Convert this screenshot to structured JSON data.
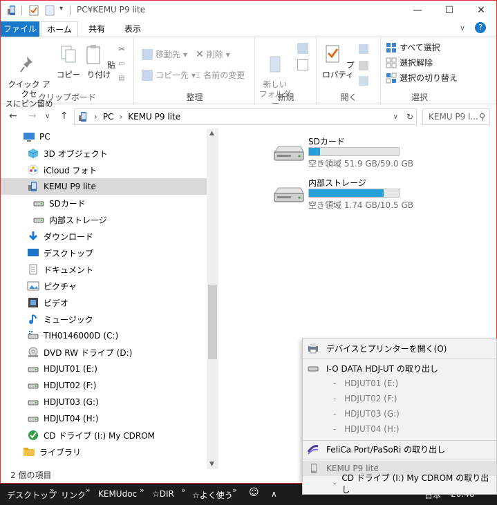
{
  "window": {
    "title": "PC¥KEMU P9 lite"
  },
  "titlebar": {
    "minimize_icon": "minimize-icon",
    "maximize_icon": "maximize-icon",
    "close_icon": "close-icon"
  },
  "tabs": [
    {
      "label": "ファイル"
    },
    {
      "label": "ホーム"
    },
    {
      "label": "共有"
    },
    {
      "label": "表示"
    }
  ],
  "ribbon": {
    "clipboard": {
      "label": "クリップボード",
      "pin": "クイック アクセ\nスにピン留め",
      "copy": "コピー",
      "paste": "貼り付け"
    },
    "organize": {
      "label": "整理",
      "move_to": "移動先",
      "copy_to": "コピー先",
      "delete": "削除",
      "rename": "名前の変更"
    },
    "new": {
      "label": "新規",
      "new_folder": "新しい\nフォルダー"
    },
    "open": {
      "label": "開く",
      "properties": "プロパティ"
    },
    "select": {
      "label": "選択",
      "select_all": "すべて選択",
      "select_none": "選択解除",
      "invert": "選択の切り替え"
    }
  },
  "address": {
    "path": [
      "PC",
      "KEMU P9 lite"
    ],
    "search_placeholder": "KEMU P9 l..."
  },
  "nav": {
    "items": [
      {
        "label": "PC",
        "icon": "pc-icon",
        "indent": 0
      },
      {
        "label": "3D オブジェクト",
        "icon": "3d-objects-icon",
        "indent": 1
      },
      {
        "label": "iCloud フォト",
        "icon": "icloud-photos-icon",
        "indent": 1
      },
      {
        "label": "KEMU P9 lite",
        "icon": "phone-icon",
        "indent": 1,
        "selected": true
      },
      {
        "label": "SDカード",
        "icon": "drive-icon",
        "indent": 2
      },
      {
        "label": "内部ストレージ",
        "icon": "drive-icon",
        "indent": 2
      },
      {
        "label": "ダウンロード",
        "icon": "download-icon",
        "indent": 1
      },
      {
        "label": "デスクトップ",
        "icon": "desktop-icon",
        "indent": 1
      },
      {
        "label": "ドキュメント",
        "icon": "documents-icon",
        "indent": 1
      },
      {
        "label": "ピクチャ",
        "icon": "pictures-icon",
        "indent": 1
      },
      {
        "label": "ビデオ",
        "icon": "videos-icon",
        "indent": 1
      },
      {
        "label": "ミュージック",
        "icon": "music-icon",
        "indent": 1
      },
      {
        "label": "TIH0146000D (C:)",
        "icon": "system-drive-icon",
        "indent": 1
      },
      {
        "label": "DVD RW ドライブ (D:)",
        "icon": "dvd-icon",
        "indent": 1
      },
      {
        "label": "HDJUT01 (E:)",
        "icon": "drive-icon",
        "indent": 1
      },
      {
        "label": "HDJUT02 (F:)",
        "icon": "drive-icon",
        "indent": 1
      },
      {
        "label": "HDJUT03 (G:)",
        "icon": "drive-icon",
        "indent": 1
      },
      {
        "label": "HDJUT04 (H:)",
        "icon": "drive-icon",
        "indent": 1
      },
      {
        "label": "CD ドライブ (I:) My CDROM",
        "icon": "cd-icon",
        "indent": 1
      },
      {
        "label": "ライブラリ",
        "icon": "library-icon",
        "indent": 0
      }
    ]
  },
  "content": {
    "drives": [
      {
        "name": "SDカード",
        "free": "空き領域 51.9 GB/59.0 GB",
        "used_fraction": 0.12
      },
      {
        "name": "内部ストレージ",
        "free": "空き領域 1.74 GB/10.5 GB",
        "used_fraction": 0.83
      }
    ]
  },
  "status": {
    "count": "2 個の項目"
  },
  "taskbar": {
    "toolbars": [
      "デスクトップ",
      "リンク",
      "KEMUdoc",
      "☆DIR",
      "☆よく使う"
    ],
    "chevron": "»",
    "lang": "日本",
    "time": "20:48"
  },
  "context_menu": {
    "devices": "デバイスとプリンターを開く(O)",
    "iodata": "I-O DATA HDJ-UT の取り出し",
    "iodata_subs": [
      "HDJUT01 (E:)",
      "HDJUT02 (F:)",
      "HDJUT03 (G:)",
      "HDJUT04 (H:)"
    ],
    "felica": "FeliCa Port/PaSoRi の取り出し",
    "kemu": "KEMU P9 lite",
    "cdrom": "CD ドライブ (I:) My CDROM の取り出し"
  },
  "colors": {
    "accent": "#1979ca",
    "bar_fill": "#26a0da",
    "selection": "#d9d9d9"
  }
}
